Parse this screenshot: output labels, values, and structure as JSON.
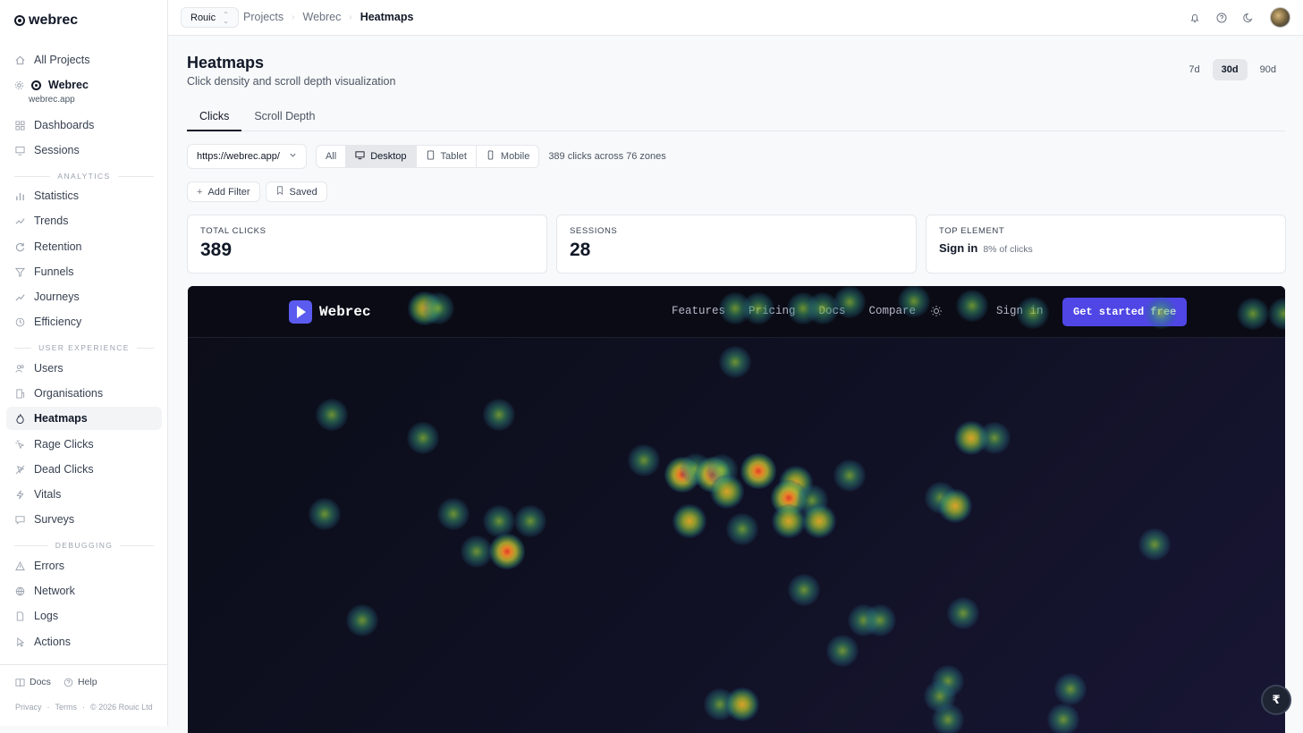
{
  "app": {
    "name": "webrec"
  },
  "sidebar": {
    "all_projects": "All Projects",
    "project": {
      "name": "Webrec",
      "domain": "webrec.app"
    },
    "top_items": [
      {
        "label": "Dashboards",
        "icon": "dashboard-icon"
      },
      {
        "label": "Sessions",
        "icon": "monitor-icon"
      }
    ],
    "sections": [
      {
        "label": "ANALYTICS",
        "items": [
          {
            "label": "Statistics",
            "icon": "bar-chart-icon"
          },
          {
            "label": "Trends",
            "icon": "trend-icon"
          },
          {
            "label": "Retention",
            "icon": "refresh-icon"
          },
          {
            "label": "Funnels",
            "icon": "funnel-icon"
          },
          {
            "label": "Journeys",
            "icon": "route-icon"
          },
          {
            "label": "Efficiency",
            "icon": "clock-icon"
          }
        ]
      },
      {
        "label": "USER EXPERIENCE",
        "items": [
          {
            "label": "Users",
            "icon": "users-icon"
          },
          {
            "label": "Organisations",
            "icon": "building-icon"
          },
          {
            "label": "Heatmaps",
            "icon": "heatmap-icon",
            "active": true
          },
          {
            "label": "Rage Clicks",
            "icon": "rage-click-icon"
          },
          {
            "label": "Dead Clicks",
            "icon": "dead-click-icon"
          },
          {
            "label": "Vitals",
            "icon": "bolt-icon"
          },
          {
            "label": "Surveys",
            "icon": "message-icon"
          }
        ]
      },
      {
        "label": "DEBUGGING",
        "items": [
          {
            "label": "Errors",
            "icon": "alert-icon"
          },
          {
            "label": "Network",
            "icon": "globe-icon"
          },
          {
            "label": "Logs",
            "icon": "document-icon"
          },
          {
            "label": "Actions",
            "icon": "pointer-icon"
          }
        ]
      }
    ],
    "footer": {
      "docs": "Docs",
      "help": "Help",
      "privacy": "Privacy",
      "terms": "Terms",
      "copyright": "© 2026 Rouic Ltd"
    }
  },
  "topbar": {
    "org": "Rouic",
    "breadcrumb": [
      "Projects",
      "Webrec",
      "Heatmaps"
    ]
  },
  "page": {
    "title": "Heatmaps",
    "subtitle": "Click density and scroll depth visualization",
    "ranges": [
      "7d",
      "30d",
      "90d"
    ],
    "active_range": "30d",
    "tabs": [
      "Clicks",
      "Scroll Depth"
    ],
    "active_tab": "Clicks",
    "url": "https://webrec.app/",
    "devices": [
      "All",
      "Desktop",
      "Tablet",
      "Mobile"
    ],
    "active_device": "Desktop",
    "click_summary": "389 clicks across 76 zones",
    "add_filter": "Add Filter",
    "saved": "Saved"
  },
  "stats": {
    "total_clicks_label": "TOTAL CLICKS",
    "total_clicks": "389",
    "sessions_label": "SESSIONS",
    "sessions": "28",
    "top_element_label": "TOP ELEMENT",
    "top_element": "Sign in",
    "top_element_pct": "8% of clicks"
  },
  "preview": {
    "site_name": "Webrec",
    "nav_links": [
      "Features",
      "Pricing",
      "Docs",
      "Compare"
    ],
    "sign_in": "Sign in",
    "cta": "Get started free"
  },
  "fab_label": "₹",
  "colors": {
    "accent": "#4f46e5",
    "preview_bg": "#0f1022",
    "active_bg": "#e5e7eb"
  }
}
